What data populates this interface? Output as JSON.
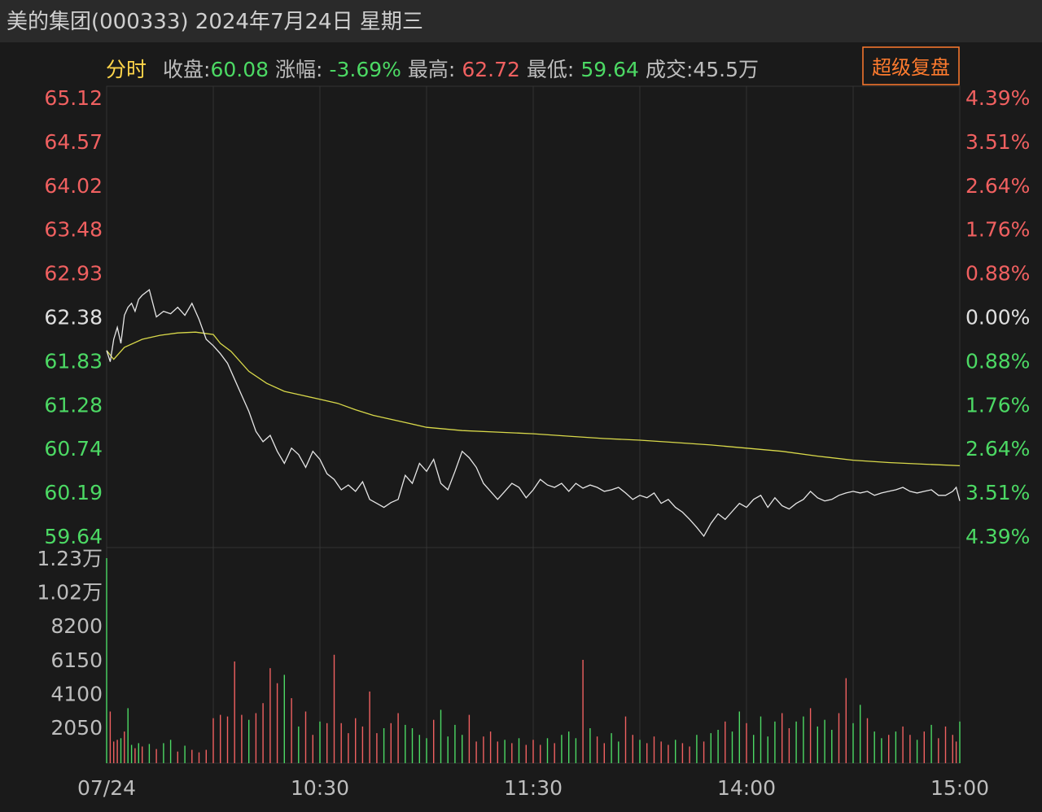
{
  "window_title": "美的集团(000333) 2024年7月24日 星期三",
  "header": {
    "mode": "分时",
    "close_label": "收盘:",
    "close_value": "60.08",
    "change_label": "涨幅:",
    "change_value": "-3.69%",
    "high_label": "最高:",
    "high_value": "62.72",
    "low_label": "最低:",
    "low_value": "59.64",
    "volume_label": "成交:45.5万",
    "replay_button": "超级复盘"
  },
  "colors": {
    "up": "#f06060",
    "down": "#4cd964",
    "neutral": "#e0e0e0",
    "price_line": "#e6e6e6",
    "avg_line": "#d9d94a",
    "mode_label": "#ffd54a",
    "replay": "#ff7b2e"
  },
  "chart_data": {
    "type": "line",
    "title": "",
    "price_axis": {
      "ticks": [
        "65.12",
        "64.57",
        "64.02",
        "63.48",
        "62.93",
        "62.38",
        "61.83",
        "61.28",
        "60.74",
        "60.19",
        "59.64"
      ],
      "ylim": [
        59.64,
        65.12
      ],
      "pre_close": 62.38
    },
    "percent_axis": {
      "ticks": [
        "4.39%",
        "3.51%",
        "2.64%",
        "1.76%",
        "0.88%",
        "0.00%",
        "0.88%",
        "1.76%",
        "2.64%",
        "3.51%",
        "4.39%"
      ]
    },
    "volume_axis": {
      "ticks": [
        "1.23万",
        "1.02万",
        "8200",
        "6150",
        "4100",
        "2050"
      ],
      "ylim": [
        0,
        12300
      ]
    },
    "x_ticks": [
      "07/24",
      "10:30",
      "11:30",
      "14:00",
      "15:00"
    ],
    "series": [
      {
        "key": "price",
        "minutes": [
          0,
          1,
          2,
          3,
          4,
          5,
          6,
          7,
          8,
          9,
          10,
          12,
          14,
          16,
          18,
          20,
          22,
          24,
          26,
          28,
          30,
          32,
          34,
          36,
          38,
          40,
          42,
          44,
          46,
          48,
          50,
          52,
          54,
          56,
          58,
          60,
          62,
          64,
          66,
          68,
          70,
          72,
          74,
          76,
          78,
          80,
          82,
          84,
          86,
          88,
          90,
          92,
          94,
          96,
          98,
          100,
          102,
          104,
          106,
          108,
          110,
          112,
          114,
          116,
          118,
          120,
          122,
          124,
          126,
          128,
          130,
          132,
          134,
          136,
          138,
          140,
          142,
          144,
          146,
          148,
          150,
          152,
          154,
          156,
          158,
          160,
          162,
          164,
          166,
          168,
          170,
          172,
          174,
          176,
          178,
          180,
          182,
          184,
          186,
          188,
          190,
          192,
          194,
          196,
          198,
          200,
          202,
          204,
          206,
          208,
          210,
          212,
          214,
          216,
          218,
          220,
          222,
          224,
          226,
          228,
          230,
          232,
          234,
          236,
          238,
          239,
          240
        ],
        "values": [
          61.96,
          61.82,
          62.1,
          62.25,
          62.05,
          62.4,
          62.5,
          62.55,
          62.45,
          62.6,
          62.65,
          62.72,
          62.38,
          62.45,
          62.42,
          62.5,
          62.4,
          62.55,
          62.35,
          62.1,
          62.02,
          61.92,
          61.8,
          61.6,
          61.4,
          61.2,
          60.95,
          60.82,
          60.9,
          60.7,
          60.55,
          60.74,
          60.66,
          60.5,
          60.7,
          60.6,
          60.42,
          60.35,
          60.22,
          60.28,
          60.2,
          60.32,
          60.1,
          60.05,
          60.0,
          60.06,
          60.1,
          60.4,
          60.3,
          60.55,
          60.45,
          60.6,
          60.3,
          60.22,
          60.45,
          60.7,
          60.62,
          60.5,
          60.3,
          60.2,
          60.1,
          60.2,
          60.3,
          60.25,
          60.12,
          60.22,
          60.35,
          60.28,
          60.25,
          60.3,
          60.2,
          60.3,
          60.24,
          60.28,
          60.25,
          60.2,
          60.22,
          60.25,
          60.18,
          60.1,
          60.15,
          60.12,
          60.18,
          60.05,
          60.1,
          60.0,
          59.94,
          59.85,
          59.75,
          59.64,
          59.8,
          59.92,
          59.85,
          59.95,
          60.05,
          60.0,
          60.1,
          60.15,
          60.0,
          60.12,
          60.02,
          59.98,
          60.05,
          60.1,
          60.2,
          60.12,
          60.08,
          60.1,
          60.15,
          60.18,
          60.2,
          60.18,
          60.2,
          60.15,
          60.18,
          60.2,
          60.22,
          60.25,
          60.2,
          60.18,
          60.2,
          60.22,
          60.15,
          60.15,
          60.2,
          60.25,
          60.08
        ]
      },
      {
        "key": "average",
        "minutes": [
          0,
          2,
          5,
          10,
          15,
          20,
          25,
          30,
          32,
          35,
          40,
          45,
          50,
          55,
          60,
          65,
          70,
          75,
          80,
          85,
          90,
          100,
          110,
          120,
          130,
          140,
          150,
          160,
          170,
          180,
          190,
          200,
          210,
          220,
          230,
          240
        ],
        "values": [
          61.96,
          61.85,
          62.0,
          62.1,
          62.15,
          62.18,
          62.19,
          62.16,
          62.05,
          61.95,
          61.7,
          61.55,
          61.45,
          61.4,
          61.35,
          61.3,
          61.22,
          61.15,
          61.1,
          61.05,
          61.0,
          60.96,
          60.94,
          60.92,
          60.89,
          60.86,
          60.84,
          60.81,
          60.78,
          60.74,
          60.7,
          60.64,
          60.59,
          60.56,
          60.54,
          60.52
        ]
      }
    ],
    "volume": [
      {
        "m": 0,
        "v": 12300,
        "d": "up"
      },
      {
        "m": 1,
        "v": 3100,
        "d": "down"
      },
      {
        "m": 2,
        "v": 1300,
        "d": "down"
      },
      {
        "m": 3,
        "v": 1400,
        "d": "down"
      },
      {
        "m": 4,
        "v": 1500,
        "d": "up"
      },
      {
        "m": 5,
        "v": 1900,
        "d": "down"
      },
      {
        "m": 6,
        "v": 3300,
        "d": "up"
      },
      {
        "m": 7,
        "v": 1100,
        "d": "up"
      },
      {
        "m": 8,
        "v": 900,
        "d": "down"
      },
      {
        "m": 9,
        "v": 1200,
        "d": "up"
      },
      {
        "m": 10,
        "v": 1000,
        "d": "down"
      },
      {
        "m": 12,
        "v": 1150,
        "d": "up"
      },
      {
        "m": 14,
        "v": 850,
        "d": "down"
      },
      {
        "m": 16,
        "v": 1200,
        "d": "up"
      },
      {
        "m": 18,
        "v": 1400,
        "d": "up"
      },
      {
        "m": 20,
        "v": 700,
        "d": "down"
      },
      {
        "m": 22,
        "v": 1050,
        "d": "up"
      },
      {
        "m": 24,
        "v": 800,
        "d": "down"
      },
      {
        "m": 26,
        "v": 650,
        "d": "down"
      },
      {
        "m": 28,
        "v": 800,
        "d": "down"
      },
      {
        "m": 30,
        "v": 2700,
        "d": "down"
      },
      {
        "m": 32,
        "v": 2900,
        "d": "down"
      },
      {
        "m": 34,
        "v": 2800,
        "d": "down"
      },
      {
        "m": 36,
        "v": 6100,
        "d": "down"
      },
      {
        "m": 38,
        "v": 2900,
        "d": "down"
      },
      {
        "m": 40,
        "v": 2600,
        "d": "up"
      },
      {
        "m": 42,
        "v": 3000,
        "d": "down"
      },
      {
        "m": 44,
        "v": 3600,
        "d": "down"
      },
      {
        "m": 46,
        "v": 5700,
        "d": "down"
      },
      {
        "m": 48,
        "v": 4800,
        "d": "down"
      },
      {
        "m": 50,
        "v": 5300,
        "d": "up"
      },
      {
        "m": 52,
        "v": 3900,
        "d": "down"
      },
      {
        "m": 54,
        "v": 2200,
        "d": "up"
      },
      {
        "m": 56,
        "v": 3100,
        "d": "down"
      },
      {
        "m": 58,
        "v": 1700,
        "d": "down"
      },
      {
        "m": 60,
        "v": 2500,
        "d": "up"
      },
      {
        "m": 62,
        "v": 2400,
        "d": "down"
      },
      {
        "m": 64,
        "v": 6500,
        "d": "down"
      },
      {
        "m": 66,
        "v": 2400,
        "d": "down"
      },
      {
        "m": 68,
        "v": 1800,
        "d": "down"
      },
      {
        "m": 70,
        "v": 2700,
        "d": "down"
      },
      {
        "m": 72,
        "v": 2200,
        "d": "down"
      },
      {
        "m": 74,
        "v": 4300,
        "d": "down"
      },
      {
        "m": 76,
        "v": 1800,
        "d": "down"
      },
      {
        "m": 78,
        "v": 2100,
        "d": "up"
      },
      {
        "m": 80,
        "v": 2400,
        "d": "down"
      },
      {
        "m": 82,
        "v": 3000,
        "d": "down"
      },
      {
        "m": 84,
        "v": 2300,
        "d": "up"
      },
      {
        "m": 86,
        "v": 2100,
        "d": "up"
      },
      {
        "m": 88,
        "v": 1700,
        "d": "up"
      },
      {
        "m": 90,
        "v": 1500,
        "d": "up"
      },
      {
        "m": 92,
        "v": 2600,
        "d": "down"
      },
      {
        "m": 94,
        "v": 3200,
        "d": "up"
      },
      {
        "m": 96,
        "v": 1600,
        "d": "up"
      },
      {
        "m": 98,
        "v": 2300,
        "d": "up"
      },
      {
        "m": 100,
        "v": 1700,
        "d": "up"
      },
      {
        "m": 102,
        "v": 2900,
        "d": "down"
      },
      {
        "m": 104,
        "v": 1300,
        "d": "down"
      },
      {
        "m": 106,
        "v": 1600,
        "d": "down"
      },
      {
        "m": 108,
        "v": 1900,
        "d": "down"
      },
      {
        "m": 110,
        "v": 1300,
        "d": "down"
      },
      {
        "m": 112,
        "v": 1400,
        "d": "up"
      },
      {
        "m": 114,
        "v": 1200,
        "d": "down"
      },
      {
        "m": 116,
        "v": 1500,
        "d": "up"
      },
      {
        "m": 118,
        "v": 1100,
        "d": "down"
      },
      {
        "m": 120,
        "v": 1400,
        "d": "down"
      },
      {
        "m": 122,
        "v": 1100,
        "d": "down"
      },
      {
        "m": 124,
        "v": 1500,
        "d": "up"
      },
      {
        "m": 126,
        "v": 1200,
        "d": "down"
      },
      {
        "m": 128,
        "v": 1700,
        "d": "up"
      },
      {
        "m": 130,
        "v": 1900,
        "d": "up"
      },
      {
        "m": 132,
        "v": 1500,
        "d": "up"
      },
      {
        "m": 134,
        "v": 6200,
        "d": "down"
      },
      {
        "m": 136,
        "v": 2100,
        "d": "up"
      },
      {
        "m": 138,
        "v": 1600,
        "d": "down"
      },
      {
        "m": 140,
        "v": 1200,
        "d": "down"
      },
      {
        "m": 142,
        "v": 1800,
        "d": "up"
      },
      {
        "m": 144,
        "v": 1300,
        "d": "up"
      },
      {
        "m": 146,
        "v": 2800,
        "d": "down"
      },
      {
        "m": 148,
        "v": 1700,
        "d": "down"
      },
      {
        "m": 150,
        "v": 1400,
        "d": "up"
      },
      {
        "m": 152,
        "v": 1200,
        "d": "down"
      },
      {
        "m": 154,
        "v": 1600,
        "d": "down"
      },
      {
        "m": 156,
        "v": 1300,
        "d": "down"
      },
      {
        "m": 158,
        "v": 1100,
        "d": "down"
      },
      {
        "m": 160,
        "v": 1400,
        "d": "up"
      },
      {
        "m": 162,
        "v": 1200,
        "d": "down"
      },
      {
        "m": 164,
        "v": 1000,
        "d": "down"
      },
      {
        "m": 166,
        "v": 1700,
        "d": "up"
      },
      {
        "m": 168,
        "v": 1300,
        "d": "down"
      },
      {
        "m": 170,
        "v": 1800,
        "d": "up"
      },
      {
        "m": 172,
        "v": 2000,
        "d": "up"
      },
      {
        "m": 174,
        "v": 2500,
        "d": "down"
      },
      {
        "m": 176,
        "v": 1900,
        "d": "up"
      },
      {
        "m": 178,
        "v": 3100,
        "d": "up"
      },
      {
        "m": 180,
        "v": 2400,
        "d": "down"
      },
      {
        "m": 182,
        "v": 1700,
        "d": "up"
      },
      {
        "m": 184,
        "v": 2800,
        "d": "up"
      },
      {
        "m": 186,
        "v": 1600,
        "d": "up"
      },
      {
        "m": 188,
        "v": 2500,
        "d": "up"
      },
      {
        "m": 190,
        "v": 3000,
        "d": "down"
      },
      {
        "m": 192,
        "v": 2100,
        "d": "down"
      },
      {
        "m": 194,
        "v": 2500,
        "d": "up"
      },
      {
        "m": 196,
        "v": 2800,
        "d": "up"
      },
      {
        "m": 198,
        "v": 3300,
        "d": "down"
      },
      {
        "m": 200,
        "v": 2200,
        "d": "up"
      },
      {
        "m": 202,
        "v": 2600,
        "d": "up"
      },
      {
        "m": 204,
        "v": 2000,
        "d": "up"
      },
      {
        "m": 206,
        "v": 3000,
        "d": "down"
      },
      {
        "m": 208,
        "v": 5100,
        "d": "down"
      },
      {
        "m": 210,
        "v": 2400,
        "d": "up"
      },
      {
        "m": 212,
        "v": 3500,
        "d": "up"
      },
      {
        "m": 214,
        "v": 2700,
        "d": "down"
      },
      {
        "m": 216,
        "v": 1900,
        "d": "up"
      },
      {
        "m": 218,
        "v": 1500,
        "d": "up"
      },
      {
        "m": 220,
        "v": 1700,
        "d": "down"
      },
      {
        "m": 222,
        "v": 1900,
        "d": "up"
      },
      {
        "m": 224,
        "v": 2200,
        "d": "down"
      },
      {
        "m": 226,
        "v": 1700,
        "d": "down"
      },
      {
        "m": 228,
        "v": 1400,
        "d": "up"
      },
      {
        "m": 230,
        "v": 1900,
        "d": "down"
      },
      {
        "m": 232,
        "v": 2300,
        "d": "up"
      },
      {
        "m": 234,
        "v": 1500,
        "d": "down"
      },
      {
        "m": 236,
        "v": 2200,
        "d": "down"
      },
      {
        "m": 238,
        "v": 1700,
        "d": "down"
      },
      {
        "m": 239,
        "v": 1300,
        "d": "down"
      },
      {
        "m": 240,
        "v": 2500,
        "d": "up"
      }
    ]
  }
}
